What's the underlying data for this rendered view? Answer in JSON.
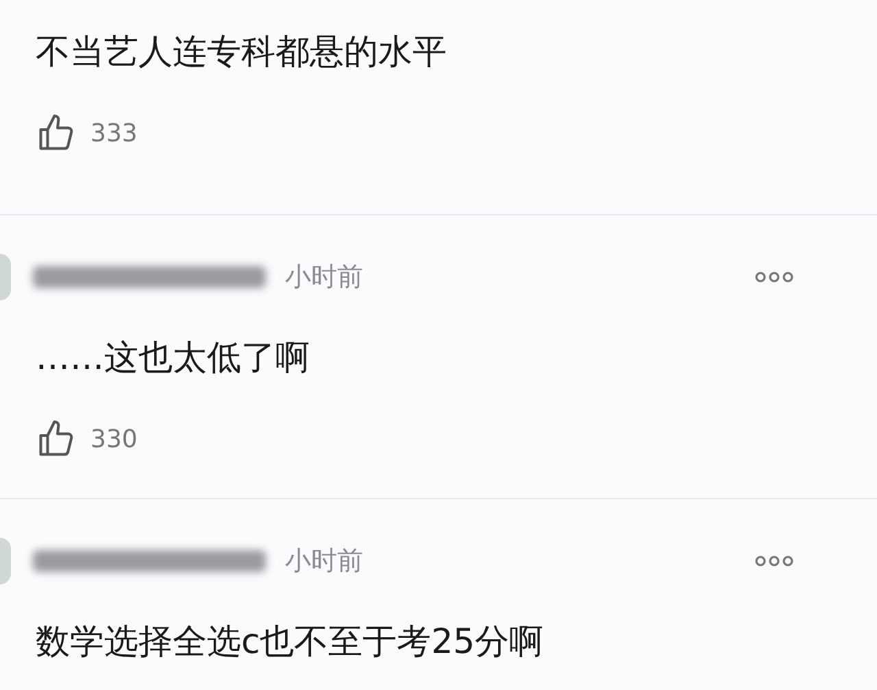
{
  "comments": [
    {
      "text": "不当艺人连专科都悬的水平",
      "likes": "333"
    },
    {
      "time": "小时前",
      "text": "……这也太低了啊",
      "likes": "330"
    },
    {
      "time": "小时前",
      "text": "数学选择全选c也不至于考25分啊"
    }
  ]
}
